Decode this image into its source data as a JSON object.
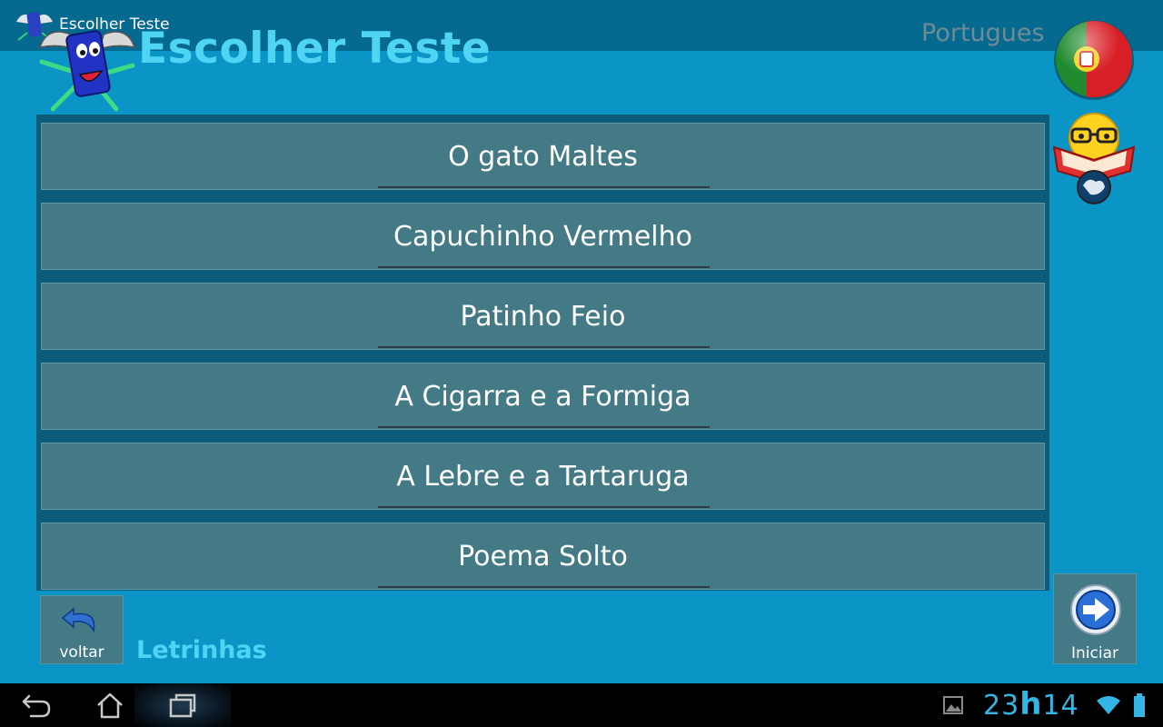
{
  "actionbar": {
    "title": "Escolher Teste"
  },
  "header": {
    "title": "Escolher Teste",
    "language": "Portugues"
  },
  "tests": [
    {
      "label": "O gato Maltes"
    },
    {
      "label": "Capuchinho Vermelho"
    },
    {
      "label": "Patinho Feio"
    },
    {
      "label": "A Cigarra e a Formiga"
    },
    {
      "label": "A Lebre e a Tartaruga"
    },
    {
      "label": "Poema Solto"
    }
  ],
  "footer": {
    "back_label": "voltar",
    "app_name": "Letrinhas",
    "start_label": "Iniciar"
  },
  "statusbar": {
    "hours": "23",
    "hour_sep": "h",
    "minutes": "14"
  },
  "colors": {
    "background": "#0b95c6",
    "actionbar": "#06698f",
    "item": "#437a86",
    "accent_text": "#4fd4f3",
    "clock": "#33b5e5"
  },
  "icons": {
    "app": "mascot-logo-icon",
    "flag": "portugal-flag-icon",
    "reader": "reading-smiley-icon",
    "back": "undo-arrow-icon",
    "start": "forward-arrow-icon"
  }
}
